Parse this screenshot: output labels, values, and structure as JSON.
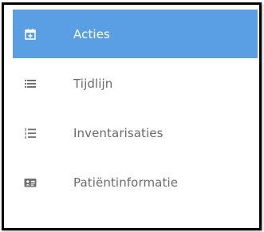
{
  "menu": {
    "items": [
      {
        "label": "Acties",
        "icon": "calendar-plus-icon",
        "active": true
      },
      {
        "label": "Tijdlijn",
        "icon": "list-icon",
        "active": false
      },
      {
        "label": "Inventarisaties",
        "icon": "ordered-list-icon",
        "active": false
      },
      {
        "label": "Patiëntinformatie",
        "icon": "id-card-icon",
        "active": false
      }
    ]
  },
  "colors": {
    "active_background": "#5a9fe3",
    "active_text": "#ffffff",
    "inactive_text": "#6b6b6b",
    "inactive_icon": "#707070",
    "border": "#000000"
  }
}
